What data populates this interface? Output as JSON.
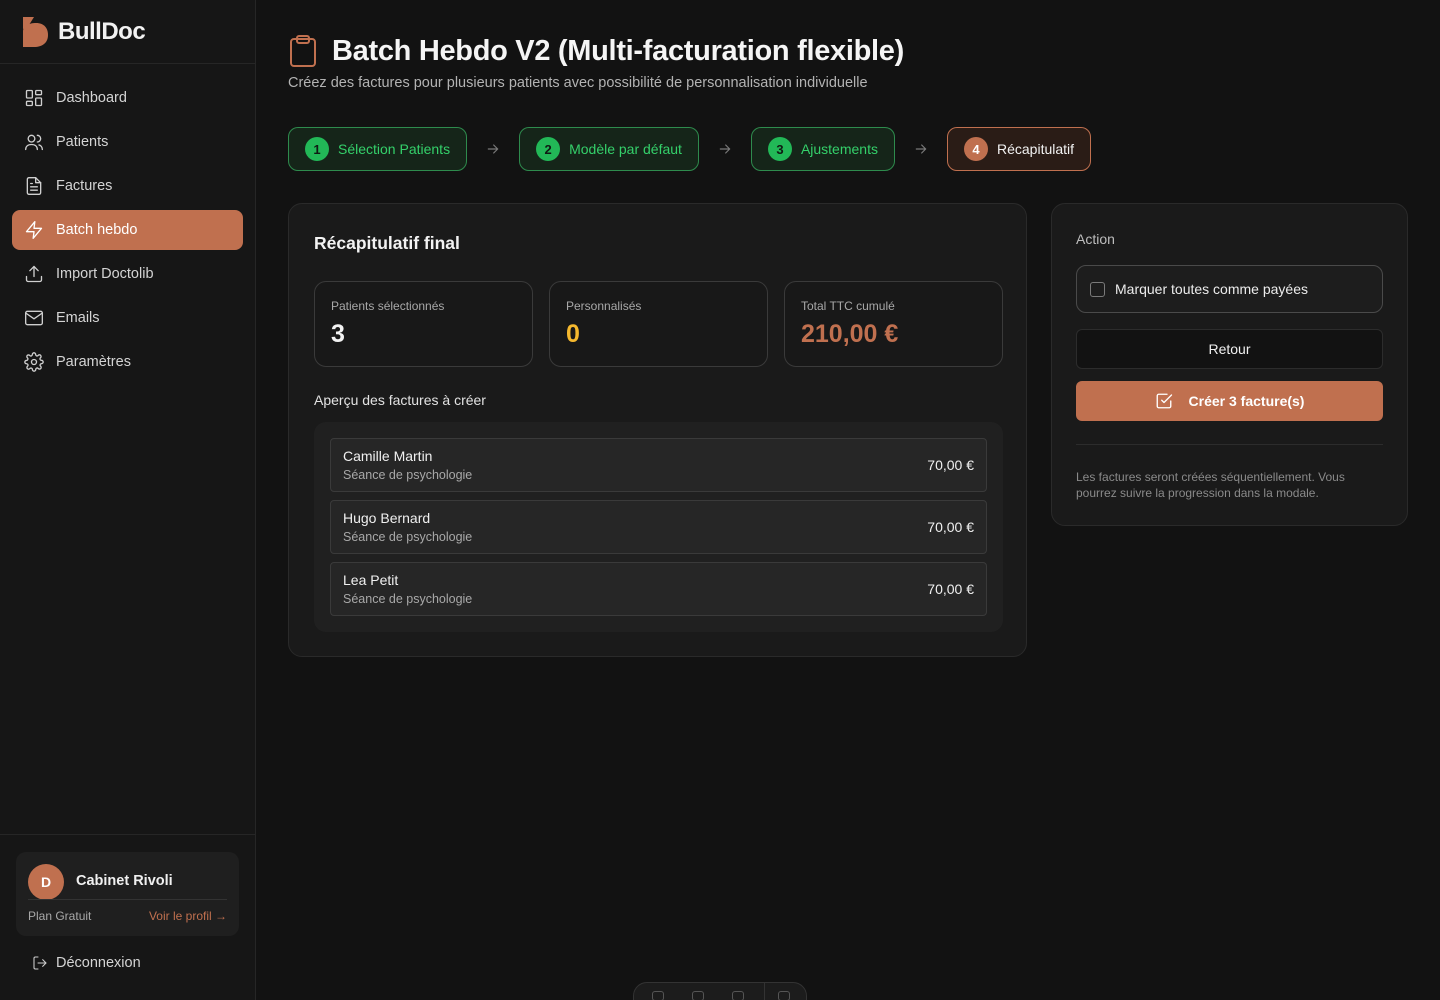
{
  "brand": {
    "name": "BullDoc",
    "accent": "#c0704f"
  },
  "sidebar": {
    "items": [
      {
        "label": "Dashboard",
        "icon": "grid-icon"
      },
      {
        "label": "Patients",
        "icon": "users-icon"
      },
      {
        "label": "Factures",
        "icon": "file-text-icon"
      },
      {
        "label": "Batch hebdo",
        "icon": "lightning-icon",
        "active": true
      },
      {
        "label": "Import Doctolib",
        "icon": "upload-icon"
      },
      {
        "label": "Emails",
        "icon": "mail-icon"
      },
      {
        "label": "Paramètres",
        "icon": "gear-icon"
      }
    ],
    "profile": {
      "avatar_initial": "D",
      "name": "Cabinet Rivoli",
      "plan": "Plan Gratuit",
      "link": "Voir le profil →"
    },
    "logout": "Déconnexion"
  },
  "header": {
    "title": "Batch Hebdo V2 (Multi-facturation flexible)",
    "subtitle": "Créez des factures pour plusieurs patients avec possibilité de personnalisation individuelle"
  },
  "steps": [
    {
      "num": "1",
      "label": "Sélection Patients",
      "state": "done"
    },
    {
      "num": "2",
      "label": "Modèle par défaut",
      "state": "done"
    },
    {
      "num": "3",
      "label": "Ajustements",
      "state": "done"
    },
    {
      "num": "4",
      "label": "Récapitulatif",
      "state": "current"
    }
  ],
  "summary": {
    "title": "Récapitulatif final",
    "stats": [
      {
        "label": "Patients sélectionnés",
        "value": "3",
        "color": "#f2f2f2"
      },
      {
        "label": "Personnalisés",
        "value": "0",
        "color": "#f5b82e"
      },
      {
        "label": "Total TTC cumulé",
        "value": "210,00 €",
        "color": "#c0704f"
      }
    ],
    "preview_label": "Aperçu des factures à créer",
    "invoices": [
      {
        "name": "Camille Martin",
        "desc": "Séance de psychologie",
        "amount": "70,00 €"
      },
      {
        "name": "Hugo Bernard",
        "desc": "Séance de psychologie",
        "amount": "70,00 €"
      },
      {
        "name": "Lea Petit",
        "desc": "Séance de psychologie",
        "amount": "70,00 €"
      }
    ]
  },
  "action": {
    "label": "Action",
    "mark_all": "Marquer toutes comme payées",
    "back": "Retour",
    "create": "Créer 3 facture(s)",
    "note": "Les factures seront créées séquentiellement. Vous pourrez suivre la progression dans la modale."
  }
}
